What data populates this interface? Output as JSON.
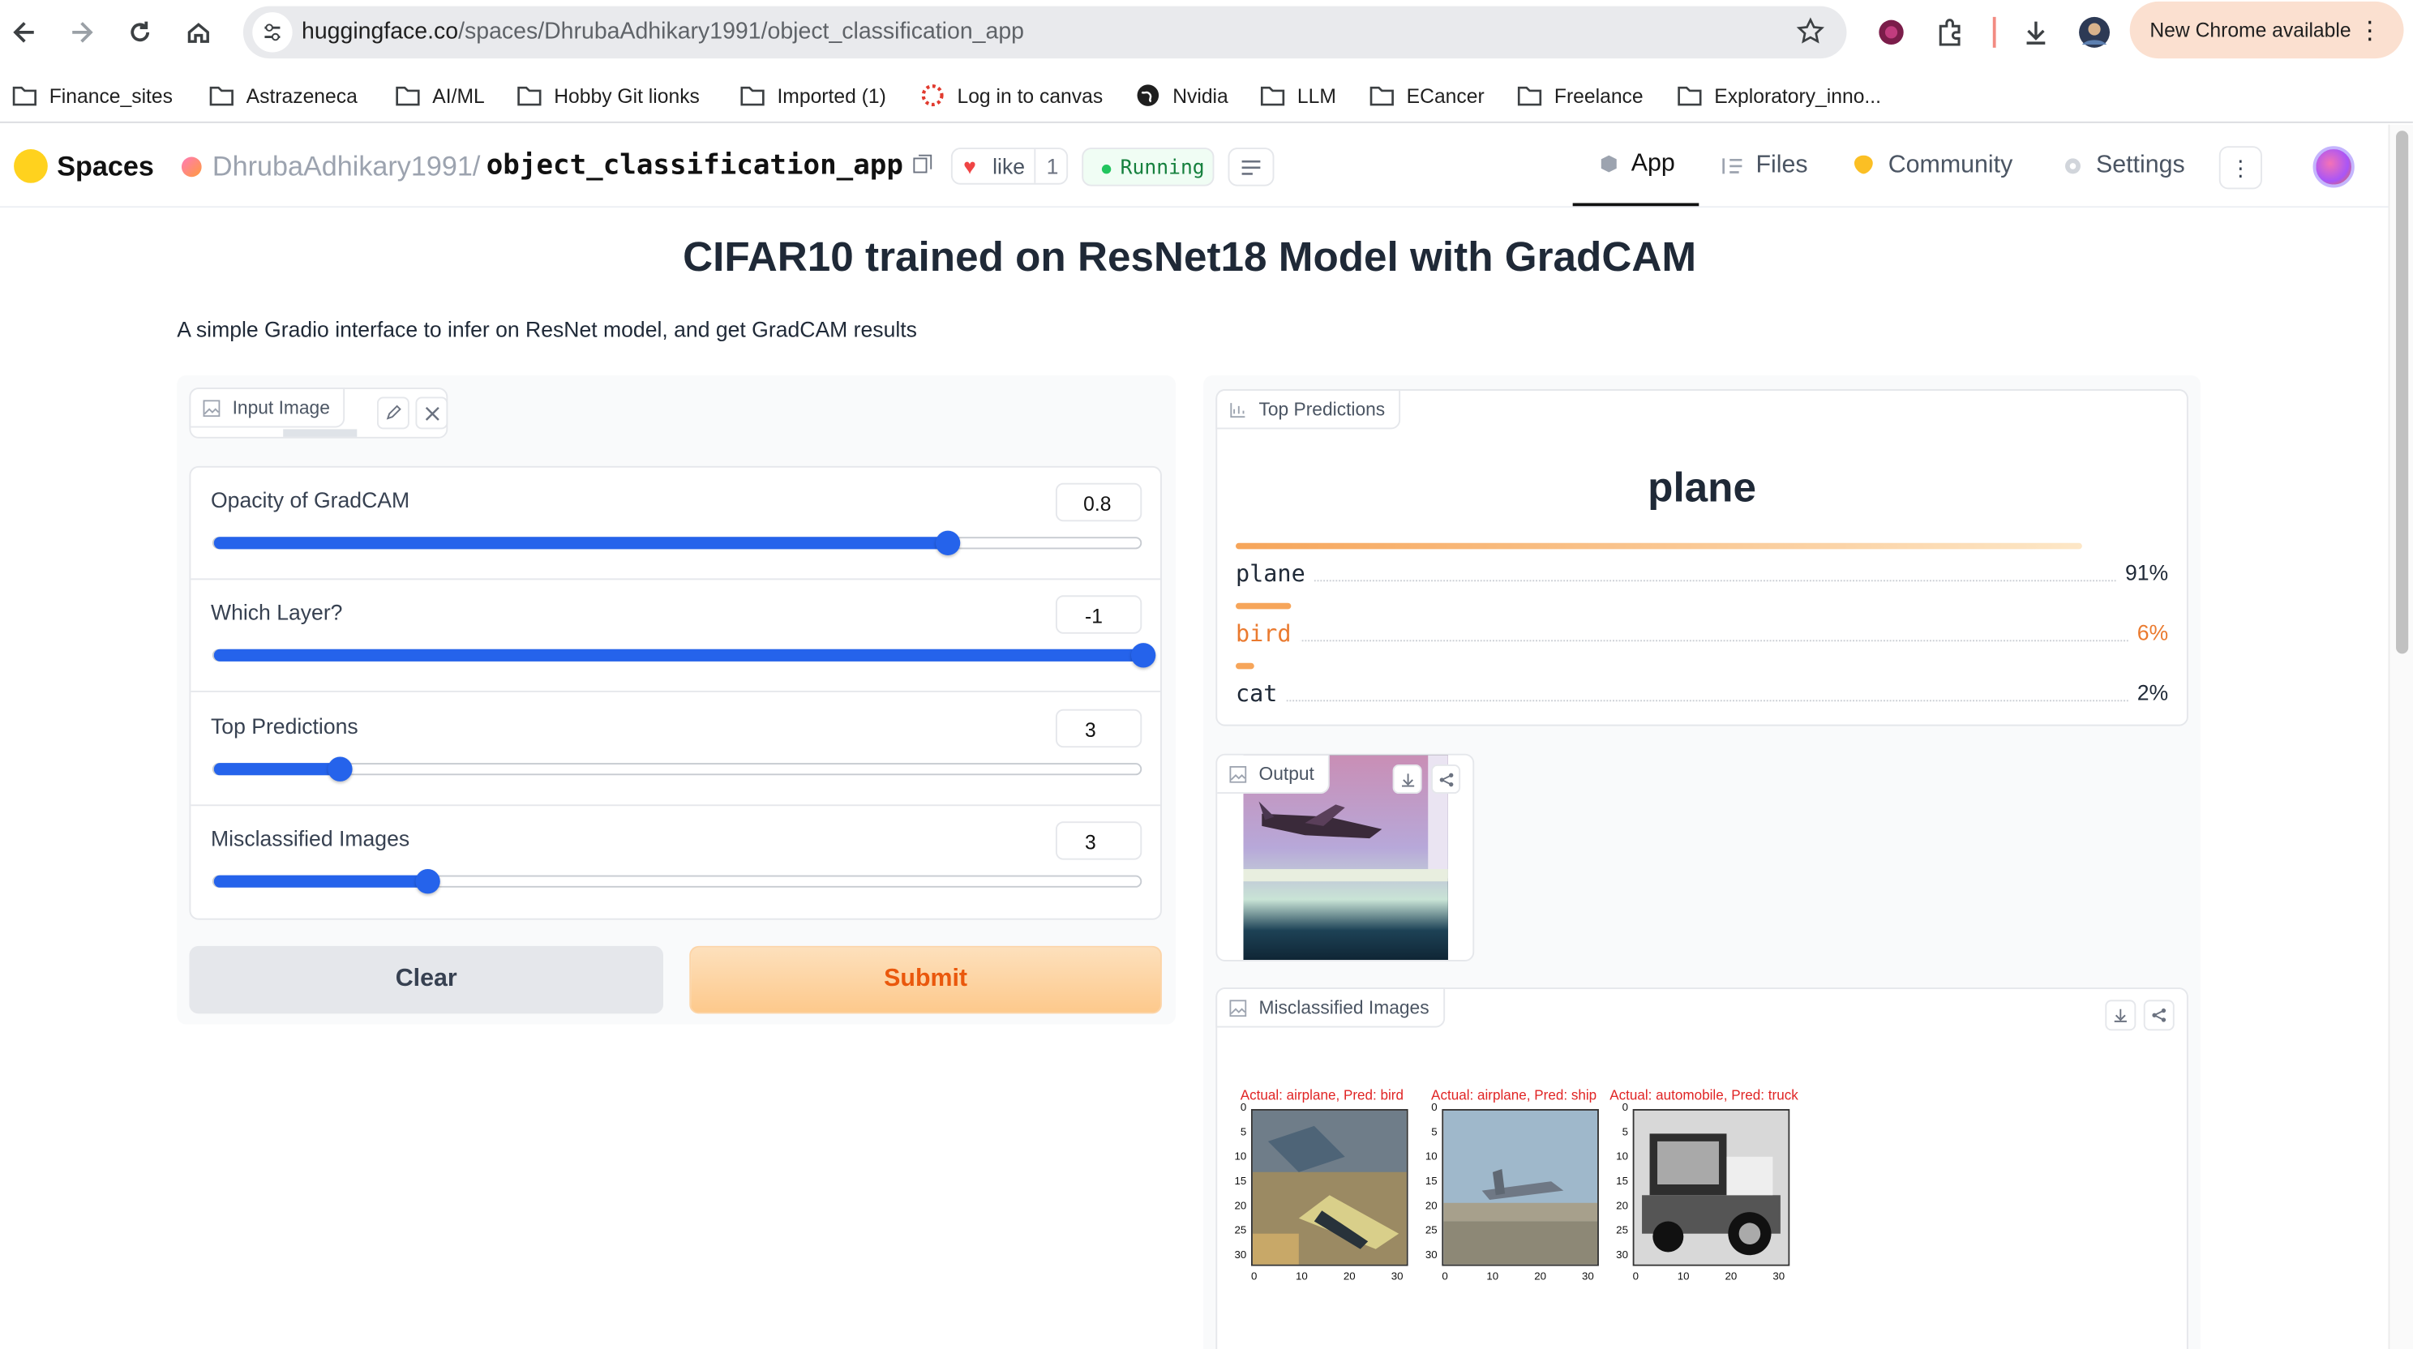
{
  "browser": {
    "url_host": "huggingface.co",
    "url_path": "/spaces/DhrubaAdhikary1991/object_classification_app",
    "new_chrome_label": "New Chrome available",
    "bookmarks": [
      "Finance_sites",
      "Astrazeneca",
      "AI/ML",
      "Hobby Git lionks",
      "Imported (1)",
      "Log in to canvas",
      "Nvidia",
      "LLM",
      "ECancer",
      "Freelance",
      "Exploratory_inno..."
    ]
  },
  "hf": {
    "spaces_label": "Spaces",
    "owner": "DhrubaAdhikary1991",
    "separator": "/",
    "app_name": "object_classification_app",
    "like_label": "like",
    "like_count": "1",
    "status": "Running",
    "tabs": {
      "app": "App",
      "files": "Files",
      "community": "Community",
      "settings": "Settings"
    }
  },
  "app": {
    "title": "CIFAR10 trained on ResNet18 Model with GradCAM",
    "description": "A simple Gradio interface to infer on ResNet model, and get GradCAM results",
    "input_image_label": "Input Image",
    "sliders": [
      {
        "label": "Opacity of GradCAM",
        "value": "0.8",
        "fraction": 0.79
      },
      {
        "label": "Which Layer?",
        "value": "-1",
        "fraction": 1.0
      },
      {
        "label": "Top Predictions",
        "value": "3",
        "fraction": 0.135
      },
      {
        "label": "Misclassified Images",
        "value": "3",
        "fraction": 0.23
      }
    ],
    "clear_label": "Clear",
    "submit_label": "Submit",
    "top_predictions": {
      "label": "Top Predictions",
      "top_class": "plane",
      "rows": [
        {
          "name": "plane",
          "pct": "91%",
          "value": 0.91
        },
        {
          "name": "bird",
          "pct": "6%",
          "value": 0.06
        },
        {
          "name": "cat",
          "pct": "2%",
          "value": 0.02
        }
      ]
    },
    "output_label": "Output",
    "misclassified": {
      "label": "Misclassified Images",
      "captions": [
        "Actual: airplane, Pred: bird",
        "Actual: airplane, Pred: ship",
        "Actual: automobile, Pred: truck"
      ],
      "y_ticks": [
        "0",
        "5",
        "10",
        "15",
        "20",
        "25",
        "30"
      ],
      "x_ticks": [
        "0",
        "10",
        "20",
        "30"
      ]
    }
  },
  "colors": {
    "accent": "#2563eb",
    "submit_text": "#ea580c",
    "highlight": "#ea7a2f",
    "caption": "#e02424"
  }
}
